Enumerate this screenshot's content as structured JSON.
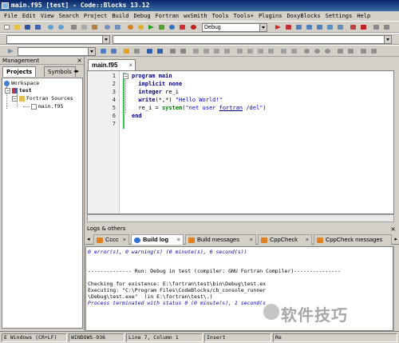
{
  "window": {
    "title": "main.f95 [test] - Code::Blocks 13.12"
  },
  "menubar": [
    "File",
    "Edit",
    "View",
    "Search",
    "Project",
    "Build",
    "Debug",
    "Fortran",
    "wxSmith",
    "Tools",
    "Tools+",
    "Plugins",
    "DoxyBlocks",
    "Settings",
    "Help"
  ],
  "toolbar": {
    "build_target": "Debug",
    "scope_combo": ""
  },
  "management": {
    "title": "Management",
    "close": "×",
    "tabs": [
      "Projects",
      "Symbols"
    ],
    "tree": {
      "workspace": "Workspace",
      "project": "test",
      "folder": "Fortran Sources",
      "file": "main.f95"
    }
  },
  "editor": {
    "tab_label": "main.f95",
    "tab_close": "×",
    "line_numbers": [
      "1",
      "2",
      "3",
      "4",
      "5",
      "6",
      "7"
    ],
    "code": {
      "l1": "program main",
      "l2": "  implicit none",
      "l3_kw": "  integer",
      "l3_rest": " re_i",
      "l4_kw": "  write",
      "l4_rest": "(*,*) ",
      "l4_str": "\"Hello World!\"",
      "l5_a": "  re_i = ",
      "l5_fn": "system",
      "l5_b": "(",
      "l5_str1": "\"net user ",
      "l5_link": "fortran",
      "l5_str2": " /del\"",
      "l5_c": ")",
      "l6": "end"
    }
  },
  "logs": {
    "title": "Logs & others",
    "close": "×",
    "tabs": [
      "Cccc",
      "Build log",
      "Build messages",
      "CppCheck",
      "CppCheck messages"
    ],
    "lines": [
      "0 error(s), 0 warning(s) (0 minute(s), 0 second(s))",
      "",
      "-------------- Run: Debug in test (compiler: GNU Fortran Compiler)---------------",
      "",
      "Checking for existence: E:\\fortran\\test\\bin\\Debug\\test.ex",
      "Executing: \"C:\\Program Files\\CodeBlocks/cb_console_runner",
      "\\Debug\\test.exe\"  (in E:\\fortran\\test\\.)",
      "Process terminated with status 0 (0 minute(s), 1 second(s"
    ]
  },
  "statusbar": {
    "eol": "E Windows (CR+LF)",
    "encoding": "WINDOWS-936",
    "position": "Line 7, Column 1",
    "mode": "Insert",
    "rw": "Re"
  },
  "watermark": "软件技巧"
}
